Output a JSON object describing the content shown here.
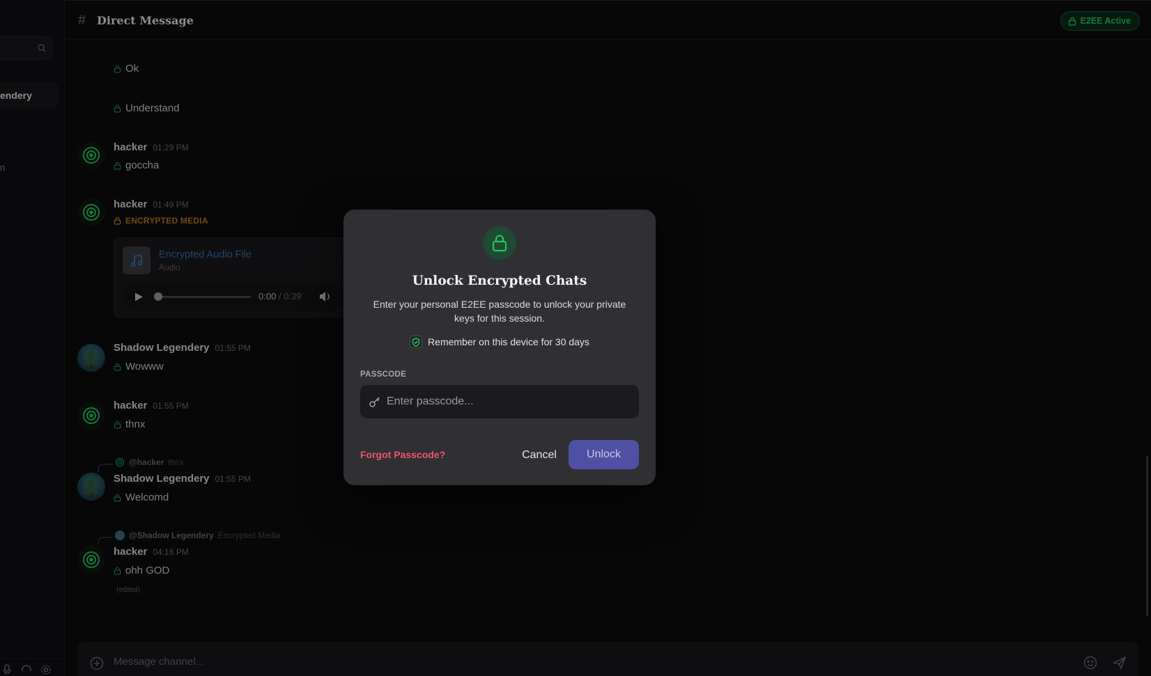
{
  "sidebar": {
    "active_item": "endery",
    "item_fragment": "n"
  },
  "header": {
    "hash": "#",
    "title": "Direct Message",
    "badge": "E2EE Active"
  },
  "messages": [
    {
      "text": "Ok"
    },
    {
      "text": "Understand"
    },
    {
      "author": "hacker",
      "time": "01:29 PM",
      "text": "goccha"
    },
    {
      "author": "hacker",
      "time": "01:49 PM",
      "label": "ENCRYPTED MEDIA",
      "media": {
        "title": "Encrypted Audio File",
        "subtitle": "Audio",
        "current": "0:00",
        "separator": "/",
        "duration": "0:39"
      }
    },
    {
      "author": "Shadow Legendery",
      "time": "01:55 PM",
      "text": "Wowww"
    },
    {
      "author": "hacker",
      "time": "01:55 PM",
      "text": "thnx"
    },
    {
      "reply_to": "@hacker",
      "reply_text": "thnx",
      "author": "Shadow Legendery",
      "time": "01:55 PM",
      "text": "Welcomd"
    },
    {
      "reply_to": "@Shadow Legendery",
      "reply_text": "Encrypted Media",
      "author": "hacker",
      "time": "04:16 PM",
      "text": "ohh GOD",
      "edited": "(edited)"
    }
  ],
  "composer": {
    "placeholder": "Message channel..."
  },
  "modal": {
    "title": "Unlock Encrypted Chats",
    "description": "Enter your personal E2EE passcode to unlock your private keys for this session.",
    "remember": "Remember on this device for 30 days",
    "remember_checked": true,
    "passcode_label": "PASSCODE",
    "passcode_placeholder": "Enter passcode...",
    "forgot": "Forgot Passcode?",
    "cancel": "Cancel",
    "unlock": "Unlock"
  },
  "colors": {
    "accent_green": "#22c55e",
    "unlock_button": "#4f4fa3",
    "forgot_link": "#f0566a",
    "encrypted_label": "#b97a1a"
  }
}
